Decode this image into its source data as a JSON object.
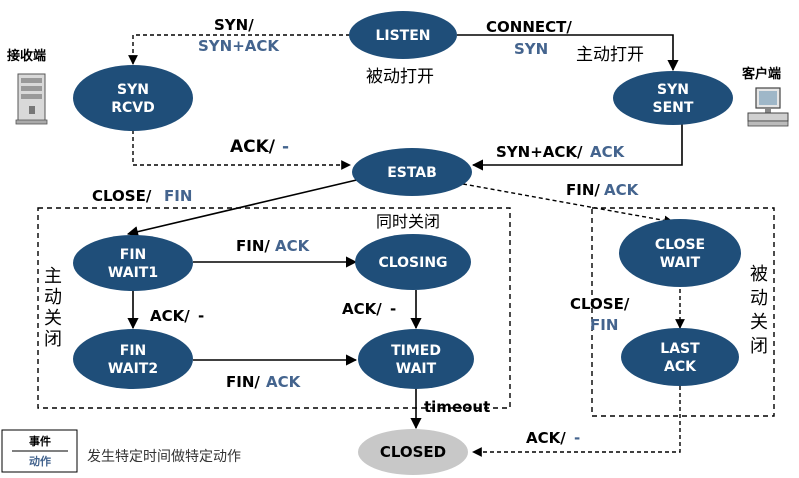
{
  "states": {
    "listen": "LISTEN",
    "syn_rcvd": [
      "SYN",
      "RCVD"
    ],
    "syn_sent": [
      "SYN",
      "SENT"
    ],
    "estab": "ESTAB",
    "fin_wait1": [
      "FIN",
      "WAIT1"
    ],
    "fin_wait2": [
      "FIN",
      "WAIT2"
    ],
    "closing": "CLOSING",
    "timed_wait": [
      "TIMED",
      "WAIT"
    ],
    "close_wait": [
      "CLOSE",
      "WAIT"
    ],
    "last_ack": [
      "LAST",
      "ACK"
    ],
    "closed": "CLOSED"
  },
  "transitions": {
    "listen_to_synrcvd": {
      "event": "SYN/",
      "action": "SYN+ACK"
    },
    "listen_to_synsent": {
      "event": "CONNECT/",
      "action": "SYN"
    },
    "synrcvd_to_estab": {
      "event": "ACK/",
      "action": "-"
    },
    "synsent_to_estab": {
      "event": "SYN+ACK/",
      "action": "ACK"
    },
    "estab_to_finwait1": {
      "event": "CLOSE/",
      "action": "FIN"
    },
    "estab_to_closewait": {
      "event": "FIN/",
      "action": "ACK"
    },
    "finwait1_to_closing": {
      "event": "FIN/",
      "action": "ACK"
    },
    "finwait1_to_finwait2": {
      "event": "ACK/",
      "action": "-"
    },
    "closing_to_timedwait": {
      "event": "ACK/",
      "action": "-"
    },
    "finwait2_to_timedwait": {
      "event": "FIN/",
      "action": "ACK"
    },
    "timedwait_to_closed": {
      "event": "timeout"
    },
    "closewait_to_lastack": {
      "event": "CLOSE/",
      "action": "FIN"
    },
    "lastack_to_closed": {
      "event": "ACK/",
      "action": "-"
    }
  },
  "labels": {
    "passive_open": "被动打开",
    "active_open": "主动打开",
    "server": "接收端",
    "client": "客户端",
    "simultaneous_close": "同时关闭",
    "active_close": [
      "主",
      "动",
      "关",
      "闭"
    ],
    "passive_close": [
      "被",
      "动",
      "关",
      "闭"
    ]
  },
  "legend": {
    "event": "事件",
    "action": "动作",
    "description": "发生特定时间做特定动作"
  },
  "colors": {
    "state_fill": "#1f4e79",
    "closed_fill": "#c8c8c8",
    "action_text": "#44648e"
  }
}
